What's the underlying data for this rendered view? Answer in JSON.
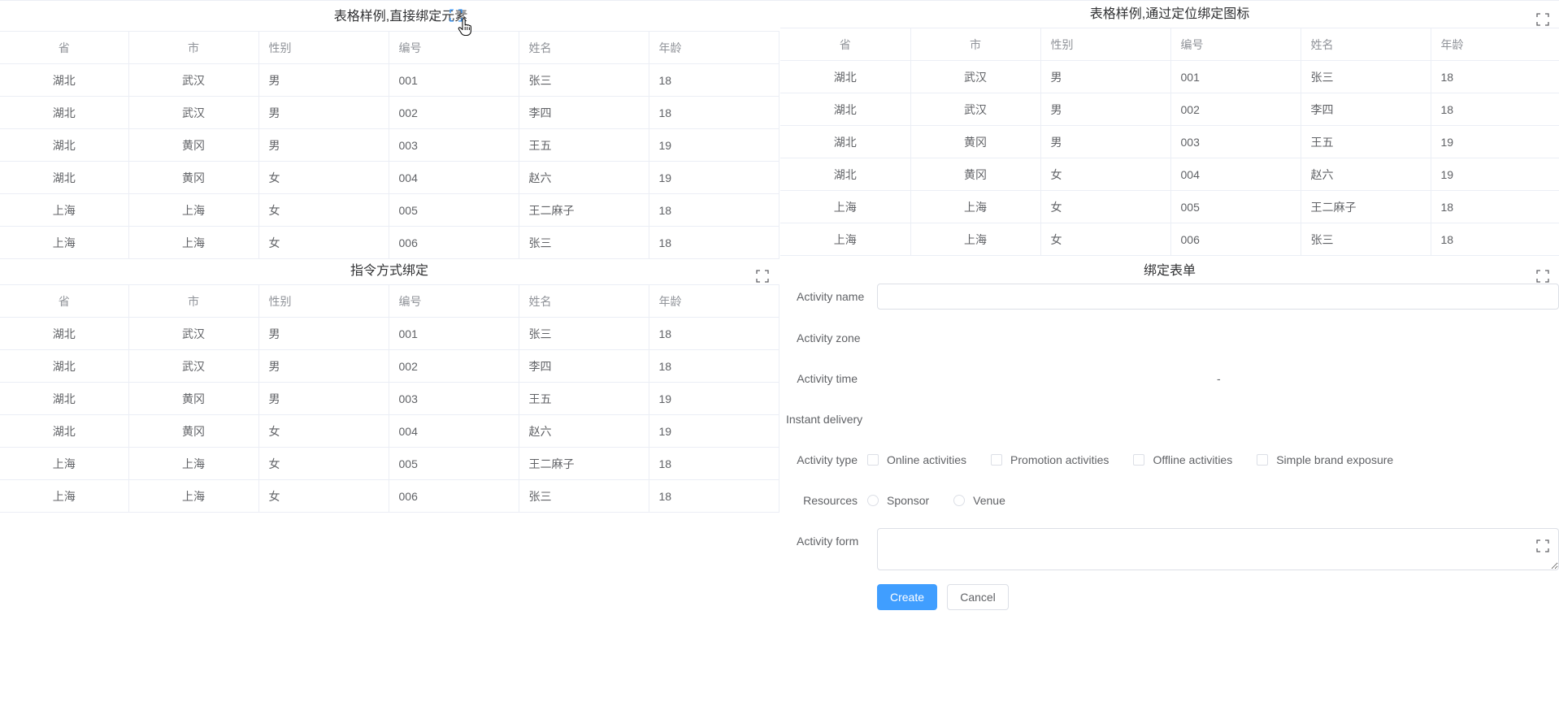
{
  "panel1": {
    "title": "表格样例,直接绑定元素"
  },
  "panel2": {
    "title": "表格样例,通过定位绑定图标"
  },
  "panel3": {
    "title": "指令方式绑定"
  },
  "panel4": {
    "title": "绑定表单"
  },
  "table": {
    "headers": [
      "省",
      "市",
      "性别",
      "编号",
      "姓名",
      "年龄"
    ],
    "rows": [
      [
        "湖北",
        "武汉",
        "男",
        "001",
        "张三",
        "18"
      ],
      [
        "湖北",
        "武汉",
        "男",
        "002",
        "李四",
        "18"
      ],
      [
        "湖北",
        "黄冈",
        "男",
        "003",
        "王五",
        "19"
      ],
      [
        "湖北",
        "黄冈",
        "女",
        "004",
        "赵六",
        "19"
      ],
      [
        "上海",
        "上海",
        "女",
        "005",
        "王二麻子",
        "18"
      ],
      [
        "上海",
        "上海",
        "女",
        "006",
        "张三",
        "18"
      ]
    ]
  },
  "form": {
    "activity_name": {
      "label": "Activity name",
      "value": ""
    },
    "activity_zone": {
      "label": "Activity zone"
    },
    "activity_time": {
      "label": "Activity time",
      "separator": "-"
    },
    "instant_delivery": {
      "label": "Instant delivery"
    },
    "activity_type": {
      "label": "Activity type",
      "options": [
        "Online activities",
        "Promotion activities",
        "Offline activities",
        "Simple brand exposure"
      ]
    },
    "resources": {
      "label": "Resources",
      "options": [
        "Sponsor",
        "Venue"
      ]
    },
    "activity_form": {
      "label": "Activity form",
      "value": ""
    },
    "create_label": "Create",
    "cancel_label": "Cancel"
  },
  "icons": {
    "fullscreen": "fullscreen-icon",
    "cursor": "hand-cursor-icon"
  },
  "colors": {
    "primary": "#409eff",
    "border": "#ebeef5",
    "text": "#606266",
    "header": "#909399",
    "title": "#303133"
  }
}
